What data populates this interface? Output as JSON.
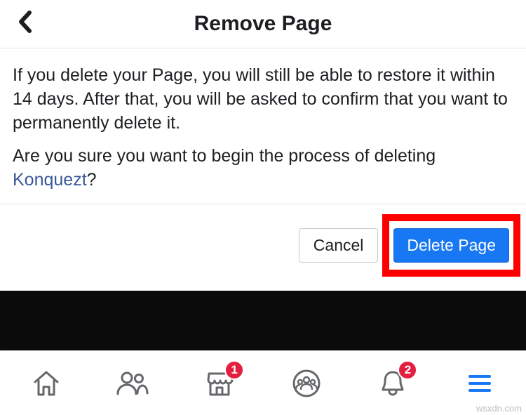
{
  "header": {
    "title": "Remove Page"
  },
  "content": {
    "info_text": "If you delete your Page, you will still be able to restore it within 14 days. After that, you will be asked to confirm that you want to permanently delete it.",
    "confirm_prefix": "Are you sure you want to begin the process of deleting ",
    "page_name": "Konquezt",
    "confirm_suffix": "?"
  },
  "actions": {
    "cancel_label": "Cancel",
    "delete_label": "Delete Page"
  },
  "nav": {
    "marketplace_badge": "1",
    "notifications_badge": "2"
  },
  "watermark": "wsxdn.com"
}
